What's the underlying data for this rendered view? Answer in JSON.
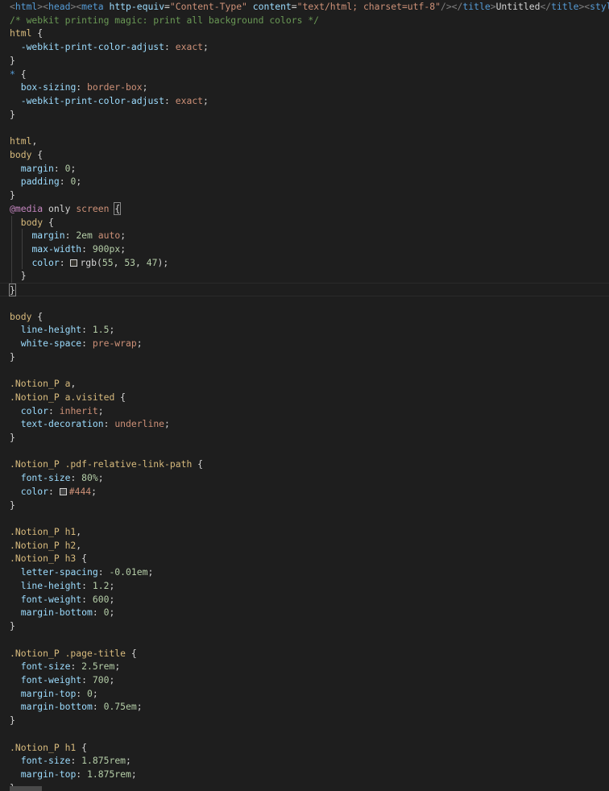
{
  "editor": {
    "lines": [
      [
        [
          "t-tag",
          "<"
        ],
        [
          "t-tagname",
          "html"
        ],
        [
          "t-tag",
          "><"
        ],
        [
          "t-tagname",
          "head"
        ],
        [
          "t-tag",
          "><"
        ],
        [
          "t-tagname",
          "meta"
        ],
        [
          "t-text",
          " "
        ],
        [
          "t-attr",
          "http-equiv"
        ],
        [
          "t-text",
          "="
        ],
        [
          "t-str",
          "\"Content-Type\""
        ],
        [
          "t-text",
          " "
        ],
        [
          "t-attr",
          "content"
        ],
        [
          "t-text",
          "="
        ],
        [
          "t-str",
          "\"text/html; charset=utf-8\""
        ],
        [
          "t-tag",
          "/></"
        ],
        [
          "t-tag",
          ""
        ],
        [
          "t-tagname",
          "title"
        ],
        [
          "t-tag",
          ">"
        ],
        [
          "t-text",
          "Untitled"
        ],
        [
          "t-tag",
          "</"
        ],
        [
          "t-tagname",
          "title"
        ],
        [
          "t-tag",
          "><"
        ],
        [
          "t-tagname",
          "style"
        ],
        [
          "t-tag",
          ">"
        ]
      ],
      [
        [
          "t-comment",
          "/* webkit printing magic: print all background colors */"
        ]
      ],
      [
        [
          "t-sel",
          "html"
        ],
        [
          "t-punc",
          " {"
        ]
      ],
      [
        [
          "t-text",
          "  "
        ],
        [
          "t-prop",
          "-webkit-print-color-adjust"
        ],
        [
          "t-punc",
          ": "
        ],
        [
          "t-val",
          "exact"
        ],
        [
          "t-punc",
          ";"
        ]
      ],
      [
        [
          "t-punc",
          "}"
        ]
      ],
      [
        [
          "t-kw",
          "*"
        ],
        [
          "t-punc",
          " {"
        ]
      ],
      [
        [
          "t-text",
          "  "
        ],
        [
          "t-prop",
          "box-sizing"
        ],
        [
          "t-punc",
          ": "
        ],
        [
          "t-val",
          "border-box"
        ],
        [
          "t-punc",
          ";"
        ]
      ],
      [
        [
          "t-text",
          "  "
        ],
        [
          "t-prop",
          "-webkit-print-color-adjust"
        ],
        [
          "t-punc",
          ": "
        ],
        [
          "t-val",
          "exact"
        ],
        [
          "t-punc",
          ";"
        ]
      ],
      [
        [
          "t-punc",
          "}"
        ]
      ],
      [],
      [
        [
          "t-sel",
          "html"
        ],
        [
          "t-punc",
          ","
        ]
      ],
      [
        [
          "t-sel",
          "body"
        ],
        [
          "t-punc",
          " {"
        ]
      ],
      [
        [
          "t-text",
          "  "
        ],
        [
          "t-prop",
          "margin"
        ],
        [
          "t-punc",
          ": "
        ],
        [
          "t-num",
          "0"
        ],
        [
          "t-punc",
          ";"
        ]
      ],
      [
        [
          "t-text",
          "  "
        ],
        [
          "t-prop",
          "padding"
        ],
        [
          "t-punc",
          ": "
        ],
        [
          "t-num",
          "0"
        ],
        [
          "t-punc",
          ";"
        ]
      ],
      [
        [
          "t-punc",
          "}"
        ]
      ],
      [
        [
          "t-at",
          "@media"
        ],
        [
          "t-text",
          " only "
        ],
        [
          "t-val",
          "screen"
        ],
        [
          "t-text",
          " "
        ],
        [
          "t-bracket",
          "{"
        ]
      ],
      [
        [
          "t-text",
          "  "
        ],
        [
          "t-sel",
          "body"
        ],
        [
          "t-punc",
          " {"
        ]
      ],
      [
        [
          "t-text",
          "    "
        ],
        [
          "t-prop",
          "margin"
        ],
        [
          "t-punc",
          ": "
        ],
        [
          "t-num",
          "2em"
        ],
        [
          "t-text",
          " "
        ],
        [
          "t-val",
          "auto"
        ],
        [
          "t-punc",
          ";"
        ]
      ],
      [
        [
          "t-text",
          "    "
        ],
        [
          "t-prop",
          "max-width"
        ],
        [
          "t-punc",
          ": "
        ],
        [
          "t-num",
          "900px"
        ],
        [
          "t-punc",
          ";"
        ]
      ],
      [
        [
          "t-text",
          "    "
        ],
        [
          "t-prop",
          "color"
        ],
        [
          "t-punc",
          ": "
        ],
        [
          "t-swatch",
          ""
        ],
        [
          "t-text",
          "rgb("
        ],
        [
          "t-num",
          "55"
        ],
        [
          "t-text",
          ", "
        ],
        [
          "t-num",
          "53"
        ],
        [
          "t-text",
          ", "
        ],
        [
          "t-num",
          "47"
        ],
        [
          "t-text",
          ")"
        ],
        [
          "t-punc",
          ";"
        ]
      ],
      [
        [
          "t-text",
          "  "
        ],
        [
          "t-punc",
          "}"
        ]
      ],
      [
        [
          "t-bracket",
          "}"
        ]
      ],
      [],
      [
        [
          "t-sel",
          "body"
        ],
        [
          "t-punc",
          " {"
        ]
      ],
      [
        [
          "t-text",
          "  "
        ],
        [
          "t-prop",
          "line-height"
        ],
        [
          "t-punc",
          ": "
        ],
        [
          "t-num",
          "1.5"
        ],
        [
          "t-punc",
          ";"
        ]
      ],
      [
        [
          "t-text",
          "  "
        ],
        [
          "t-prop",
          "white-space"
        ],
        [
          "t-punc",
          ": "
        ],
        [
          "t-val",
          "pre-wrap"
        ],
        [
          "t-punc",
          ";"
        ]
      ],
      [
        [
          "t-punc",
          "}"
        ]
      ],
      [],
      [
        [
          "t-sel",
          ".Notion_P a"
        ],
        [
          "t-punc",
          ","
        ]
      ],
      [
        [
          "t-sel",
          ".Notion_P a.visited"
        ],
        [
          "t-punc",
          " {"
        ]
      ],
      [
        [
          "t-text",
          "  "
        ],
        [
          "t-prop",
          "color"
        ],
        [
          "t-punc",
          ": "
        ],
        [
          "t-val",
          "inherit"
        ],
        [
          "t-punc",
          ";"
        ]
      ],
      [
        [
          "t-text",
          "  "
        ],
        [
          "t-prop",
          "text-decoration"
        ],
        [
          "t-punc",
          ": "
        ],
        [
          "t-val",
          "underline"
        ],
        [
          "t-punc",
          ";"
        ]
      ],
      [
        [
          "t-punc",
          "}"
        ]
      ],
      [],
      [
        [
          "t-sel",
          ".Notion_P .pdf-relative-link-path"
        ],
        [
          "t-punc",
          " {"
        ]
      ],
      [
        [
          "t-text",
          "  "
        ],
        [
          "t-prop",
          "font-size"
        ],
        [
          "t-punc",
          ": "
        ],
        [
          "t-num",
          "80%"
        ],
        [
          "t-punc",
          ";"
        ]
      ],
      [
        [
          "t-text",
          "  "
        ],
        [
          "t-prop",
          "color"
        ],
        [
          "t-punc",
          ": "
        ],
        [
          "t-swatch",
          ""
        ],
        [
          "t-val",
          "#444"
        ],
        [
          "t-punc",
          ";"
        ]
      ],
      [
        [
          "t-punc",
          "}"
        ]
      ],
      [],
      [
        [
          "t-sel",
          ".Notion_P h1"
        ],
        [
          "t-punc",
          ","
        ]
      ],
      [
        [
          "t-sel",
          ".Notion_P h2"
        ],
        [
          "t-punc",
          ","
        ]
      ],
      [
        [
          "t-sel",
          ".Notion_P h3"
        ],
        [
          "t-punc",
          " {"
        ]
      ],
      [
        [
          "t-text",
          "  "
        ],
        [
          "t-prop",
          "letter-spacing"
        ],
        [
          "t-punc",
          ": "
        ],
        [
          "t-num",
          "-0.01em"
        ],
        [
          "t-punc",
          ";"
        ]
      ],
      [
        [
          "t-text",
          "  "
        ],
        [
          "t-prop",
          "line-height"
        ],
        [
          "t-punc",
          ": "
        ],
        [
          "t-num",
          "1.2"
        ],
        [
          "t-punc",
          ";"
        ]
      ],
      [
        [
          "t-text",
          "  "
        ],
        [
          "t-prop",
          "font-weight"
        ],
        [
          "t-punc",
          ": "
        ],
        [
          "t-num",
          "600"
        ],
        [
          "t-punc",
          ";"
        ]
      ],
      [
        [
          "t-text",
          "  "
        ],
        [
          "t-prop",
          "margin-bottom"
        ],
        [
          "t-punc",
          ": "
        ],
        [
          "t-num",
          "0"
        ],
        [
          "t-punc",
          ";"
        ]
      ],
      [
        [
          "t-punc",
          "}"
        ]
      ],
      [],
      [
        [
          "t-sel",
          ".Notion_P .page-title"
        ],
        [
          "t-punc",
          " {"
        ]
      ],
      [
        [
          "t-text",
          "  "
        ],
        [
          "t-prop",
          "font-size"
        ],
        [
          "t-punc",
          ": "
        ],
        [
          "t-num",
          "2.5rem"
        ],
        [
          "t-punc",
          ";"
        ]
      ],
      [
        [
          "t-text",
          "  "
        ],
        [
          "t-prop",
          "font-weight"
        ],
        [
          "t-punc",
          ": "
        ],
        [
          "t-num",
          "700"
        ],
        [
          "t-punc",
          ";"
        ]
      ],
      [
        [
          "t-text",
          "  "
        ],
        [
          "t-prop",
          "margin-top"
        ],
        [
          "t-punc",
          ": "
        ],
        [
          "t-num",
          "0"
        ],
        [
          "t-punc",
          ";"
        ]
      ],
      [
        [
          "t-text",
          "  "
        ],
        [
          "t-prop",
          "margin-bottom"
        ],
        [
          "t-punc",
          ": "
        ],
        [
          "t-num",
          "0.75em"
        ],
        [
          "t-punc",
          ";"
        ]
      ],
      [
        [
          "t-punc",
          "}"
        ]
      ],
      [],
      [
        [
          "t-sel",
          ".Notion_P h1"
        ],
        [
          "t-punc",
          " {"
        ]
      ],
      [
        [
          "t-text",
          "  "
        ],
        [
          "t-prop",
          "font-size"
        ],
        [
          "t-punc",
          ": "
        ],
        [
          "t-num",
          "1.875rem"
        ],
        [
          "t-punc",
          ";"
        ]
      ],
      [
        [
          "t-text",
          "  "
        ],
        [
          "t-prop",
          "margin-top"
        ],
        [
          "t-punc",
          ": "
        ],
        [
          "t-num",
          "1.875rem"
        ],
        [
          "t-punc",
          ";"
        ]
      ],
      [
        [
          "t-punc",
          "}"
        ]
      ]
    ],
    "current_line": 21,
    "swatch_colors": [
      "#37352f",
      "#444444"
    ]
  }
}
